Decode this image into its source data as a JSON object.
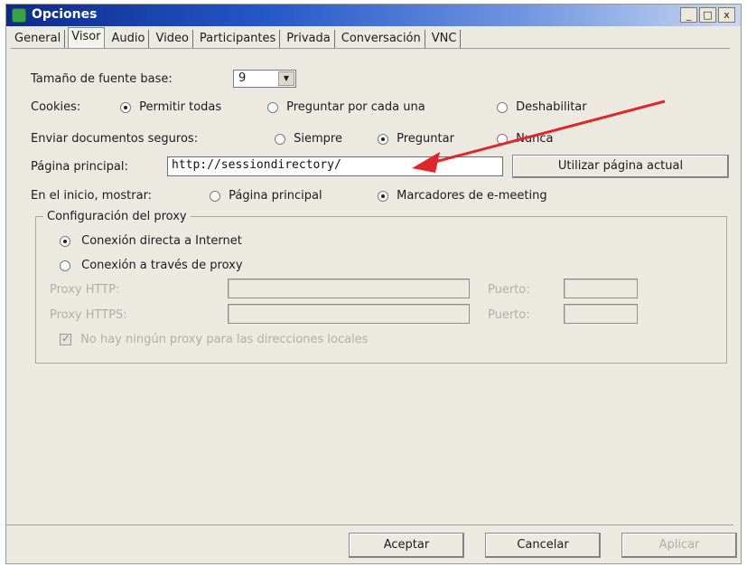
{
  "window": {
    "title": "Opciones",
    "controls": {
      "minimize": "_",
      "maximize": "□",
      "close": "x"
    }
  },
  "tabs": [
    {
      "label": "General",
      "active": false
    },
    {
      "label": "Visor",
      "active": true
    },
    {
      "label": "Audio",
      "active": false
    },
    {
      "label": "Video",
      "active": false
    },
    {
      "label": "Participantes",
      "active": false
    },
    {
      "label": "Privada",
      "active": false
    },
    {
      "label": "Conversación",
      "active": false
    },
    {
      "label": "VNC",
      "active": false
    }
  ],
  "font_size": {
    "label": "Tamaño de fuente base:",
    "value": "9"
  },
  "cookies": {
    "label": "Cookies:",
    "options": [
      {
        "label": "Permitir todas",
        "selected": true
      },
      {
        "label": "Preguntar por cada una",
        "selected": false
      },
      {
        "label": "Deshabilitar",
        "selected": false
      }
    ]
  },
  "secure_docs": {
    "label": "Enviar documentos seguros:",
    "options": [
      {
        "label": "Siempre",
        "selected": false
      },
      {
        "label": "Preguntar",
        "selected": true
      },
      {
        "label": "Nunca",
        "selected": false
      }
    ]
  },
  "homepage": {
    "label": "Página principal:",
    "value": "http://sessiondirectory/",
    "use_current_button": "Utilizar página actual"
  },
  "startup": {
    "label": "En el inicio, mostrar:",
    "options": [
      {
        "label": "Página principal",
        "selected": false
      },
      {
        "label": "Marcadores de e-meeting",
        "selected": true
      }
    ]
  },
  "proxy": {
    "group_title": "Configuración del proxy",
    "direct": {
      "label": "Conexión directa a Internet",
      "selected": true
    },
    "via_proxy": {
      "label": "Conexión a través de proxy",
      "selected": false
    },
    "http_label": "Proxy HTTP:",
    "https_label": "Proxy HTTPS:",
    "port_label": "Puerto:",
    "no_proxy_local": {
      "label": "No hay ningún proxy para las direcciones locales",
      "checked": true
    }
  },
  "footer": {
    "accept": "Aceptar",
    "cancel": "Cancelar",
    "apply": "Aplicar"
  },
  "colors": {
    "annotation_arrow": "#e0262b",
    "window_bg": "#ece9e0",
    "title_bar": "#0c2a8c"
  }
}
